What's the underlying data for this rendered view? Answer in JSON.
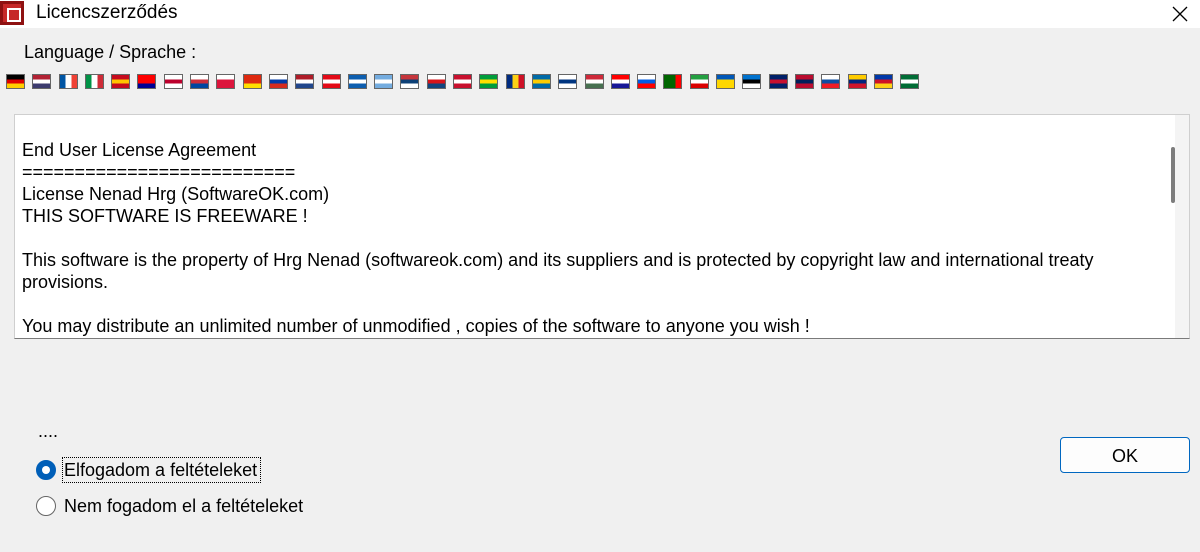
{
  "window": {
    "title": "Licencszerződés",
    "close_icon": "close-icon"
  },
  "language": {
    "label": "Language / Sprache :",
    "flags": [
      {
        "name": "german",
        "colors": [
          "#000000",
          "#dd0000",
          "#ffce00"
        ],
        "dir": "h"
      },
      {
        "name": "english-us",
        "colors": [
          "#b22234",
          "#ffffff",
          "#3c3b6e"
        ],
        "dir": "h"
      },
      {
        "name": "french",
        "colors": [
          "#0055a4",
          "#ffffff",
          "#ef4135"
        ],
        "dir": "v"
      },
      {
        "name": "italian",
        "colors": [
          "#009246",
          "#ffffff",
          "#ce2b37"
        ],
        "dir": "v"
      },
      {
        "name": "spanish",
        "colors": [
          "#c60b1e",
          "#ffc400",
          "#c60b1e"
        ],
        "dir": "h"
      },
      {
        "name": "chinese-traditional",
        "colors": [
          "#fe0000",
          "#fe0000",
          "#000095"
        ],
        "dir": "h"
      },
      {
        "name": "japanese",
        "colors": [
          "#ffffff",
          "#bc002d",
          "#ffffff"
        ],
        "dir": "h"
      },
      {
        "name": "korean",
        "colors": [
          "#ffffff",
          "#cd2e3a",
          "#0047a0"
        ],
        "dir": "h"
      },
      {
        "name": "polish",
        "colors": [
          "#ffffff",
          "#dc143c",
          "#dc143c"
        ],
        "dir": "h"
      },
      {
        "name": "chinese",
        "colors": [
          "#de2910",
          "#de2910",
          "#ffde00"
        ],
        "dir": "h"
      },
      {
        "name": "russian",
        "colors": [
          "#ffffff",
          "#0039a6",
          "#d52b1e"
        ],
        "dir": "h"
      },
      {
        "name": "dutch",
        "colors": [
          "#ae1c28",
          "#ffffff",
          "#21468b"
        ],
        "dir": "h"
      },
      {
        "name": "turkish",
        "colors": [
          "#e30a17",
          "#ffffff",
          "#e30a17"
        ],
        "dir": "h"
      },
      {
        "name": "greek",
        "colors": [
          "#0d5eaf",
          "#ffffff",
          "#0d5eaf"
        ],
        "dir": "h"
      },
      {
        "name": "argentinian",
        "colors": [
          "#74acdf",
          "#ffffff",
          "#74acdf"
        ],
        "dir": "h"
      },
      {
        "name": "serbian",
        "colors": [
          "#c6363c",
          "#0c4076",
          "#ffffff"
        ],
        "dir": "h"
      },
      {
        "name": "czech",
        "colors": [
          "#ffffff",
          "#d7141a",
          "#11457e"
        ],
        "dir": "h"
      },
      {
        "name": "danish",
        "colors": [
          "#c8102e",
          "#ffffff",
          "#c8102e"
        ],
        "dir": "h"
      },
      {
        "name": "brazilian",
        "colors": [
          "#009c3b",
          "#ffdf00",
          "#009c3b"
        ],
        "dir": "h"
      },
      {
        "name": "romanian",
        "colors": [
          "#002b7f",
          "#fcd116",
          "#ce1126"
        ],
        "dir": "v"
      },
      {
        "name": "swedish",
        "colors": [
          "#006aa7",
          "#fecc00",
          "#006aa7"
        ],
        "dir": "h"
      },
      {
        "name": "finnish",
        "colors": [
          "#ffffff",
          "#003580",
          "#ffffff"
        ],
        "dir": "h"
      },
      {
        "name": "hungarian",
        "colors": [
          "#ce2939",
          "#ffffff",
          "#477050"
        ],
        "dir": "h"
      },
      {
        "name": "croatian",
        "colors": [
          "#ff0000",
          "#ffffff",
          "#171796"
        ],
        "dir": "h"
      },
      {
        "name": "slovenian",
        "colors": [
          "#ffffff",
          "#005ce5",
          "#ff0000"
        ],
        "dir": "h"
      },
      {
        "name": "portuguese",
        "colors": [
          "#006600",
          "#006600",
          "#ff0000"
        ],
        "dir": "v"
      },
      {
        "name": "persian",
        "colors": [
          "#239f40",
          "#ffffff",
          "#da0000"
        ],
        "dir": "h"
      },
      {
        "name": "ukrainian",
        "colors": [
          "#0057b7",
          "#ffd700",
          "#ffd700"
        ],
        "dir": "h"
      },
      {
        "name": "estonian",
        "colors": [
          "#0072ce",
          "#000000",
          "#ffffff"
        ],
        "dir": "h"
      },
      {
        "name": "english-uk",
        "colors": [
          "#012169",
          "#c8102e",
          "#012169"
        ],
        "dir": "h"
      },
      {
        "name": "norwegian",
        "colors": [
          "#ba0c2f",
          "#00205b",
          "#ba0c2f"
        ],
        "dir": "h"
      },
      {
        "name": "slovak",
        "colors": [
          "#ffffff",
          "#0b4ea2",
          "#ee1c25"
        ],
        "dir": "h"
      },
      {
        "name": "venezuelan",
        "colors": [
          "#ffcc00",
          "#00247d",
          "#cf142b"
        ],
        "dir": "h"
      },
      {
        "name": "filipino",
        "colors": [
          "#0038a8",
          "#ce1126",
          "#fcd116"
        ],
        "dir": "h"
      },
      {
        "name": "arabic",
        "colors": [
          "#006c35",
          "#ffffff",
          "#006c35"
        ],
        "dir": "h"
      }
    ]
  },
  "license": {
    "text": "End User License Agreement\n==========================\nLicense Nenad Hrg (SoftwareOK.com)\nTHIS SOFTWARE IS FREEWARE !\n\nThis software is the property of Hrg Nenad (softwareok.com) and its suppliers and is protected by copyright law and international treaty provisions.\n\nYou may distribute an unlimited number of unmodified , copies of the software to anyone you wish !"
  },
  "dots": "....",
  "options": {
    "accept_label": "Elfogadom a feltételeket",
    "accept_checked": true,
    "decline_label": "Nem fogadom el a feltételeket",
    "decline_checked": false
  },
  "buttons": {
    "ok_label": "OK"
  },
  "colors": {
    "accent": "#005fb8",
    "background": "#f0f0f0"
  }
}
